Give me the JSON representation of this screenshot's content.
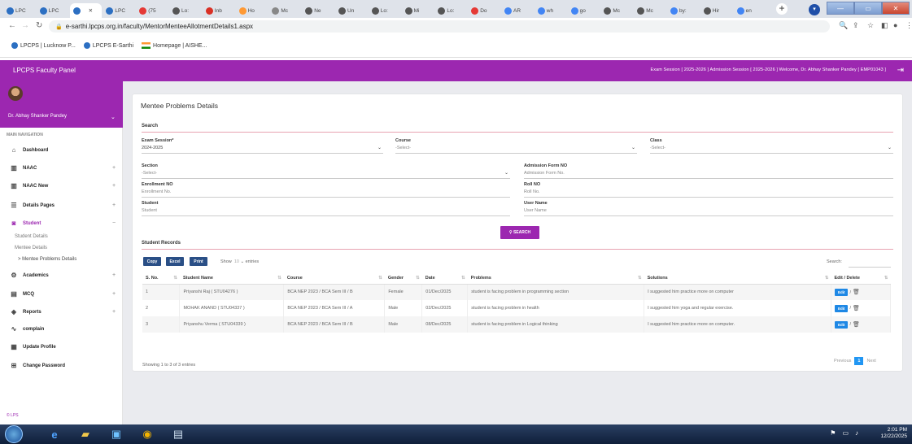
{
  "browser": {
    "tabs": [
      {
        "label": "LPC",
        "color": "#2c6fc2"
      },
      {
        "label": "LPC",
        "color": "#2c6fc2"
      },
      {
        "label": "",
        "color": "#2c6fc2"
      },
      {
        "label": "LPC",
        "color": "#2c6fc2"
      },
      {
        "label": "(75",
        "color": "#e53935"
      },
      {
        "label": "Lo:",
        "color": "#555"
      },
      {
        "label": "Inb",
        "color": "#d93025"
      },
      {
        "label": "Ho",
        "color": "#ff9933"
      },
      {
        "label": "Mc",
        "color": "#888"
      },
      {
        "label": "Ne",
        "color": "#555"
      },
      {
        "label": "Un",
        "color": "#555"
      },
      {
        "label": "Lo:",
        "color": "#555"
      },
      {
        "label": "Mi",
        "color": "#555"
      },
      {
        "label": "Lo:",
        "color": "#555"
      },
      {
        "label": "Do",
        "color": "#e53935"
      },
      {
        "label": "AR",
        "color": "#4285f4"
      },
      {
        "label": "wh",
        "color": "#4285f4"
      },
      {
        "label": "go",
        "color": "#4285f4"
      },
      {
        "label": "Mc",
        "color": "#555"
      },
      {
        "label": "Mc",
        "color": "#555"
      },
      {
        "label": "by:",
        "color": "#4285f4"
      },
      {
        "label": "Hir",
        "color": "#555"
      },
      {
        "label": "en",
        "color": "#4285f4"
      }
    ],
    "new_tab": "+",
    "url": "e-sarthi.lpcps.org.in/faculty/MentorMenteeAllotmentDetails1.aspx",
    "bookmarks": [
      {
        "label": "LPCPS | Lucknow P..."
      },
      {
        "label": "LPCPS E-Sarthi"
      },
      {
        "label": "Homepage | AISHE..."
      }
    ]
  },
  "header": {
    "title": "LPCPS Faculty Panel",
    "info": "Exam Session [ 2025-2026 ]   Admission Session [ 2025-2026 ]   Welcome, Dr. Abhay Shanker Pandey [ EMP01043 ]"
  },
  "sidebar": {
    "user_name": "Dr. Abhay Shanker Pandey",
    "nav_heading": "MAIN NAVIGATION",
    "items": [
      {
        "label": "Dashboard",
        "icon": "home-icon",
        "glyph": "⌂",
        "expand": ""
      },
      {
        "label": "NAAC",
        "icon": "book-icon",
        "glyph": "▥",
        "expand": "+"
      },
      {
        "label": "NAAC New",
        "icon": "book-icon",
        "glyph": "▥",
        "expand": "+"
      },
      {
        "label": "Details Pages",
        "icon": "list-icon",
        "glyph": "☰",
        "expand": "+"
      },
      {
        "label": "Student",
        "icon": "student-icon",
        "glyph": "◙",
        "expand": "−"
      },
      {
        "label": "Academics",
        "icon": "graduation-icon",
        "glyph": "⚙",
        "expand": "+"
      },
      {
        "label": "MCQ",
        "icon": "mcq-icon",
        "glyph": "▤",
        "expand": "+"
      },
      {
        "label": "Reports",
        "icon": "reports-icon",
        "glyph": "◈",
        "expand": "+"
      },
      {
        "label": "complain",
        "icon": "complain-icon",
        "glyph": "∿",
        "expand": ""
      },
      {
        "label": "Update Profile",
        "icon": "profile-icon",
        "glyph": "▦",
        "expand": ""
      },
      {
        "label": "Change Password",
        "icon": "password-icon",
        "glyph": "⊞",
        "expand": ""
      }
    ],
    "student_sub": [
      "Student Details",
      "Mentee Details",
      "> Mentee Problems Details"
    ],
    "footer": "© LPS"
  },
  "main": {
    "title": "Mentee Problems Details",
    "search_heading": "Search",
    "fields": {
      "exam_session": {
        "label": "Exam Session*",
        "value": "2024-2025"
      },
      "course": {
        "label": "Course",
        "value": "-Select-"
      },
      "class": {
        "label": "Class",
        "value": "-Select-"
      },
      "section": {
        "label": "Section",
        "value": "-Select-"
      },
      "admission_form_no": {
        "label": "Admission Form NO",
        "placeholder": "Admission Form No."
      },
      "enrollment_no": {
        "label": "Enrollment NO",
        "placeholder": "Enrollment No."
      },
      "roll_no": {
        "label": "Roll NO",
        "placeholder": "Roll No."
      },
      "student": {
        "label": "Student",
        "placeholder": "Student"
      },
      "user_name": {
        "label": "User Name",
        "placeholder": "User Name"
      }
    },
    "search_button": "SEARCH",
    "records_heading": "Student Records",
    "buttons": {
      "copy": "Copy",
      "excel": "Excel",
      "print": "Print"
    },
    "show_prefix": "Show",
    "show_value": "10",
    "show_suffix": "entries",
    "search_label": "Search:",
    "columns": [
      "S. No.",
      "Student Name",
      "Course",
      "Gender",
      "Date",
      "Problems",
      "Solutions",
      "Edit / Delete"
    ],
    "rows": [
      {
        "sno": "1",
        "name": "Priyanshi Raj ( STU04276 )",
        "course": "BCA NEP 2023 / BCA Sem III / B",
        "gender": "Female",
        "date": "01/Dec/2025",
        "problem": "student is facing problem in programming section",
        "solution": "I suggested him practice more on computer"
      },
      {
        "sno": "2",
        "name": "MOHAK ANAND ( STU04337 )",
        "course": "BCA NEP 2023 / BCA Sem III / A",
        "gender": "Male",
        "date": "02/Dec/2025",
        "problem": "student is facing problem in health",
        "solution": "I suggested him yoga and regular exercise."
      },
      {
        "sno": "3",
        "name": "Priyanshu Verma ( STU04339 )",
        "course": "BCA NEP 2023 / BCA Sem III / B",
        "gender": "Male",
        "date": "08/Dec/2025",
        "problem": "student is facing problem in Logical thinking",
        "solution": "I suggested him practice more on computer."
      }
    ],
    "edit_label": "Edit",
    "delete_separator": "/",
    "showing": "Showing 1 to 3 of 3 entries",
    "pager": {
      "prev": "Previous",
      "current": "1",
      "next": "Next"
    }
  },
  "taskbar": {
    "time": "2:01 PM",
    "date": "12/22/2025"
  }
}
